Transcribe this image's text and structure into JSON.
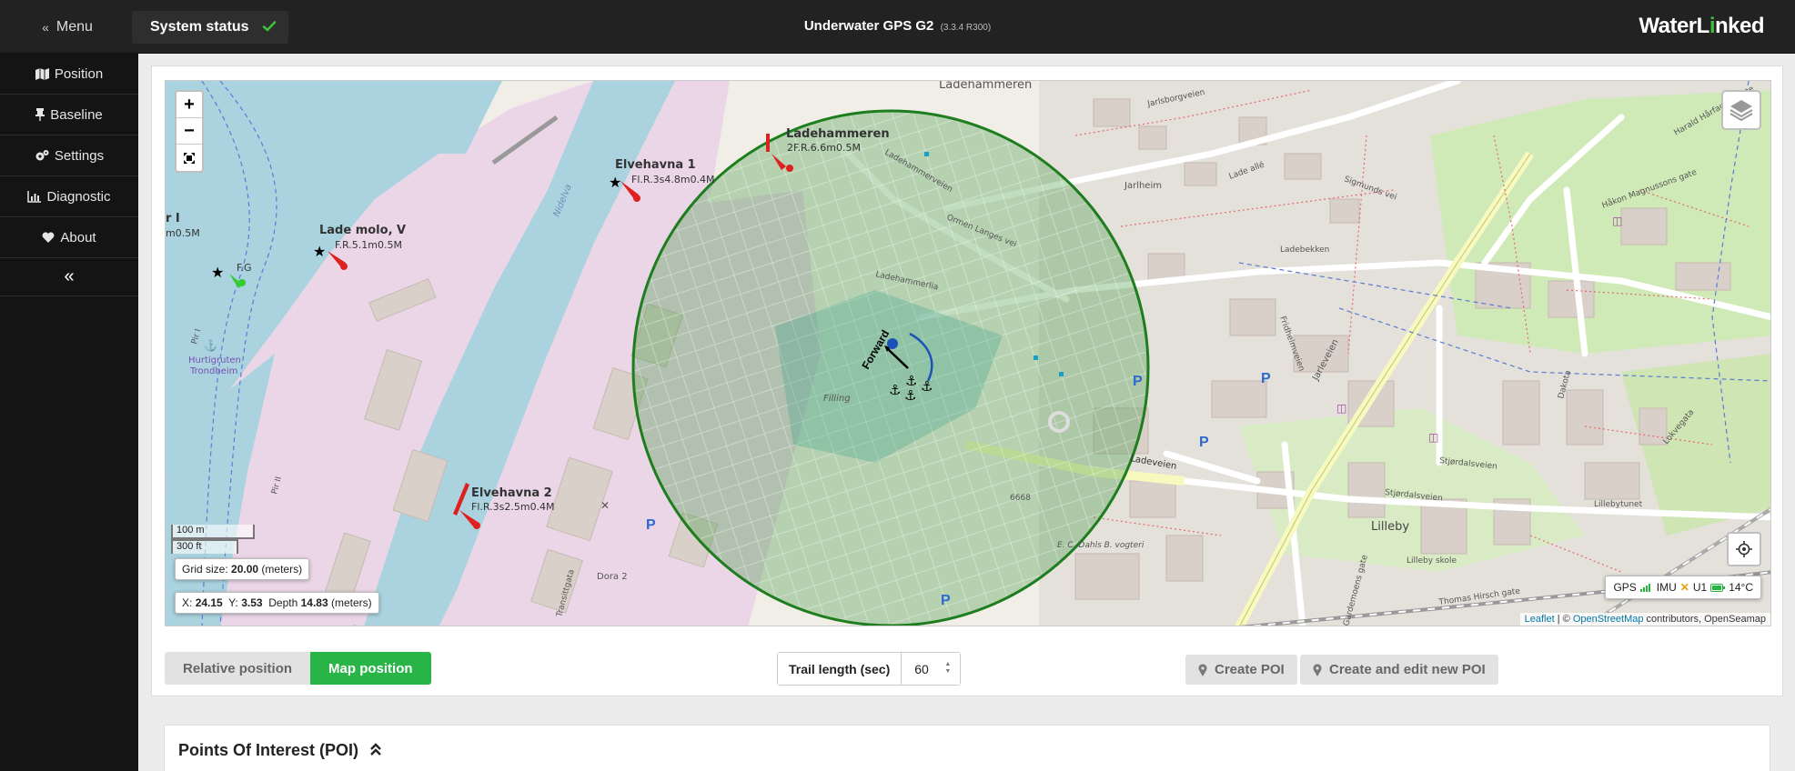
{
  "topbar": {
    "menu_label": "Menu",
    "status_label": "System status",
    "title": "Underwater GPS G2",
    "version": "(3.3.4 R300)",
    "logo_part1": "WaterL",
    "logo_accent": "i",
    "logo_part2": "nked"
  },
  "sidebar": {
    "items": [
      {
        "label": "Position",
        "icon": "map-icon"
      },
      {
        "label": "Baseline",
        "icon": "pin-icon"
      },
      {
        "label": "Settings",
        "icon": "gears-icon"
      },
      {
        "label": "Diagnostic",
        "icon": "chart-icon"
      },
      {
        "label": "About",
        "icon": "heart-icon"
      }
    ],
    "collapse_glyph": "«"
  },
  "map": {
    "zoom_in": "+",
    "zoom_out": "−",
    "scale_metric": "100 m",
    "scale_imperial": "300 ft",
    "grid_label": "Grid size:",
    "grid_value": "20.00",
    "grid_unit": "(meters)",
    "x_label": "X:",
    "x_value": "24.15",
    "y_label": "Y:",
    "y_value": "3.53",
    "depth_label": "Depth",
    "depth_value": "14.83",
    "depth_unit": "(meters)",
    "forward_label": "Forward",
    "sensors": {
      "gps": "GPS",
      "imu": "IMU",
      "u1": "U1",
      "temp": "14°C"
    },
    "attribution": {
      "leaflet": "Leaflet",
      "sep": " | © ",
      "osm": "OpenStreetMap",
      "rest": " contributors, OpenSeamap"
    },
    "labels": {
      "ladehammeren_top": "Ladehammeren",
      "ladehammeren_light": "Ladehammeren",
      "ladehammeren_light_sub": "2F.R.6.6m0.5M",
      "elvehavna1": "Elvehavna 1",
      "elvehavna1_sub": "Fl.R.3s4.8m0.4M",
      "lade_molo": "Lade molo, V",
      "lade_molo_sub": "F.R.5.1m0.5M",
      "left_partial": "r I",
      "left_partial_sub": "m0.5M",
      "fg": "F.G",
      "elvehavna2": "Elvehavna 2",
      "elvehavna2_sub": "Fl.R.3s2.5m0.4M",
      "hurtigruten": "Hurtigruten",
      "hurtigruten2": "Trondheim",
      "nidelva": "Nidelva",
      "filling": "Filling",
      "ladehammerlia": "Ladehammerlia",
      "ormen": "Ormen Langes vei",
      "ladehammerveien": "Ladehammerveien",
      "jarlheim": "Jarlheim",
      "jarlsborgveien": "Jarlsborgveien",
      "lade_alle": "Lade allé",
      "ladebekken": "Ladebekken",
      "jarleveien": "Jarleveien",
      "sjordalsveien": "Stjørdalsveien",
      "lilleby": "Lilleby",
      "lillebyskole": "Lilleby skole",
      "lillebytunet": "Lillebytunet",
      "dora2": "Dora 2",
      "ladeveien": "Ladeveien",
      "e6668": "6668",
      "transitgata": "Transittgata",
      "piri": "Pir I",
      "pirii": "Pir II",
      "harald": "Harald Hårfagres gate",
      "haakon": "Håkon Magnussons gate",
      "dakota": "Dakota",
      "frid": "Fridheimveien",
      "sig": "Sigmunds vei",
      "gardemoen": "Gardemoens gate",
      "thomas": "Thomas Hirsch gate",
      "dahls": "E. C. Dahls B. vogteri",
      "lokvegata": "Lokvegata",
      "vikkenveien": "Stjørdalsveien"
    }
  },
  "controls": {
    "relative_position": "Relative position",
    "map_position": "Map position",
    "trail_label": "Trail length (sec)",
    "trail_value": "60",
    "create_poi": "Create POI",
    "create_edit_poi": "Create and edit new POI"
  },
  "poi": {
    "title": "Points Of Interest (POI)",
    "chevron": "⌃⌃"
  },
  "colors": {
    "accent_green": "#28b446",
    "range_circle": "#1e7d1e",
    "water": "#aad3df",
    "harbor": "#ead6e6"
  }
}
